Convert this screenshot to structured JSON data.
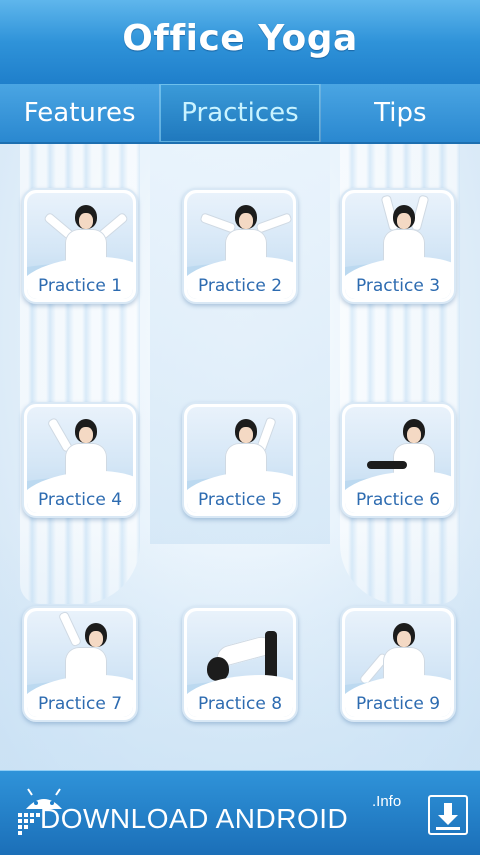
{
  "app": {
    "title": "Office Yoga"
  },
  "tabs": [
    {
      "label": "Features",
      "active": false
    },
    {
      "label": "Practices",
      "active": true
    },
    {
      "label": "Tips",
      "active": false
    }
  ],
  "practices": [
    {
      "label": "Practice 1"
    },
    {
      "label": "Practice 2"
    },
    {
      "label": "Practice 3"
    },
    {
      "label": "Practice 4"
    },
    {
      "label": "Practice 5"
    },
    {
      "label": "Practice 6"
    },
    {
      "label": "Practice 7"
    },
    {
      "label": "Practice 8"
    },
    {
      "label": "Practice 9"
    }
  ],
  "banner": {
    "text": "DOWNLOAD ANDROID",
    "suffix": ".Info",
    "icon": "download-icon",
    "logo_icon": "android-robot-icon"
  },
  "colors": {
    "accent": "#2f93d9",
    "tab_active_text": "#c9f3ff",
    "label_text": "#2d6bb0"
  }
}
